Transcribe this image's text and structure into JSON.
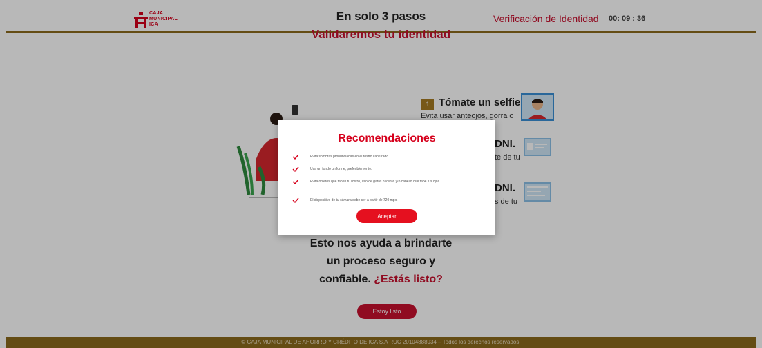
{
  "header": {
    "logo_lines": [
      "CAJA",
      "MUNICIPAL",
      "ICA"
    ],
    "title": "Verificación de Identidad",
    "timer": "00: 09 : 36"
  },
  "main": {
    "heading": "En solo 3 pasos",
    "subheading": "Validaremos tu identidad",
    "steps": [
      {
        "number": "1",
        "title": "Tómate un selfie.",
        "description": "Evita usar anteojos, gorra o"
      },
      {
        "title": "DNI.",
        "description": "te de tu"
      },
      {
        "title": "DNI.",
        "description": "s de tu"
      }
    ],
    "bottom_line1": "Esto nos ayuda a brindarte",
    "bottom_line2": "un proceso seguro y",
    "bottom_line3": "confiable.",
    "bottom_accent": "¿Estás listo?",
    "ready_button": "Estoy listo"
  },
  "footer": {
    "text": "© CAJA MUNICIPAL DE AHORRO Y CRÉDITO DE ICA S.A RUC 20104888934 – Todos los derechos reservados."
  },
  "modal": {
    "title": "Recomendaciones",
    "recommendations": [
      "Evita sombras pronunciadas en el rostro capturado.",
      "Usa un fondo uniforme, preferiblemente.",
      "Evita objetos que tapen tu rostro, uso de gafas oscuras y/o cabello que tape tus ojos.",
      "El dispositivo de tu cámara debe ser a partir de 720 mpx."
    ],
    "accept_button": "Aceptar"
  },
  "colors": {
    "brand_red": "#c8102e",
    "gold": "#8b6a1c",
    "check_red": "#d6001c"
  }
}
